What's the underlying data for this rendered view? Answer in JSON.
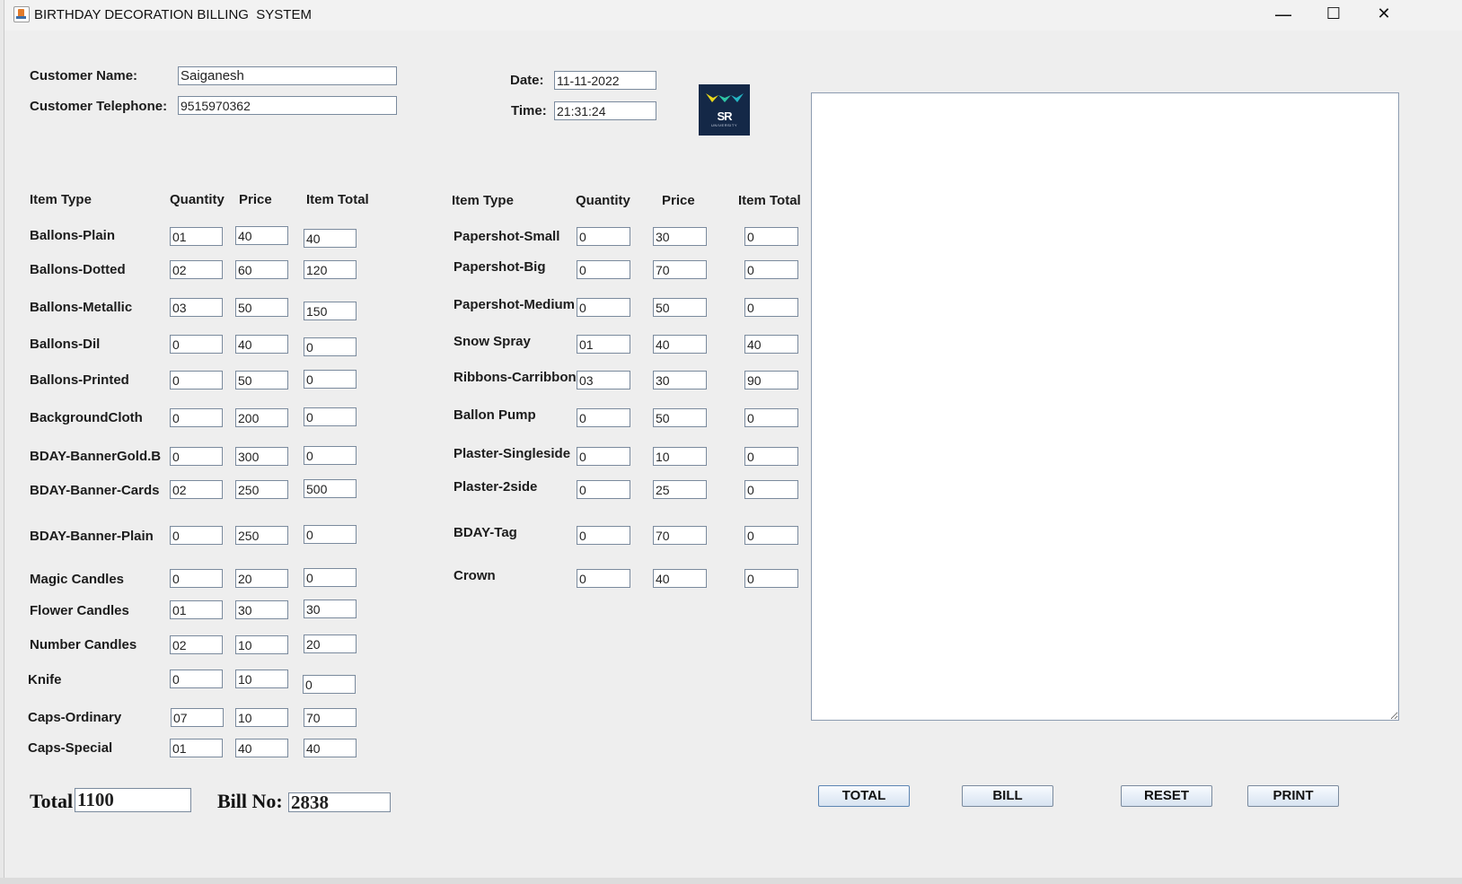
{
  "window": {
    "title": "BIRTHDAY DECORATION BILLING  SYSTEM",
    "minimize_glyph": "—",
    "maximize_glyph": "☐",
    "close_glyph": "✕"
  },
  "customer": {
    "name_label": "Customer Name:",
    "name_value": "Saiganesh",
    "phone_label": "Customer Telephone:",
    "phone_value": "9515970362"
  },
  "datetime": {
    "date_label": "Date:",
    "date_value": "11-11-2022",
    "time_label": "Time:",
    "time_value": "21:31:24"
  },
  "logo": {
    "text": "SR",
    "subtext": "UNIVERSITY",
    "colors": {
      "background": "#142847",
      "yellow": "#e8d71c",
      "teal": "#24b5c4"
    }
  },
  "headers": {
    "left": {
      "item": "Item Type",
      "qty": "Quantity",
      "price": "Price",
      "total": "Item Total"
    },
    "right": {
      "item": "Item Type",
      "qty": "Quantity",
      "price": "Price",
      "total": "Item Total"
    }
  },
  "left_items": [
    {
      "name": "Ballons-Plain",
      "qty": "01",
      "price": "40",
      "total": "40"
    },
    {
      "name": "Ballons-Dotted",
      "qty": "02",
      "price": "60",
      "total": "120"
    },
    {
      "name": "Ballons-Metallic",
      "qty": "03",
      "price": "50",
      "total": "150"
    },
    {
      "name": "Ballons-Dil",
      "qty": "0",
      "price": "40",
      "total": "0"
    },
    {
      "name": "Ballons-Printed",
      "qty": "0",
      "price": "50",
      "total": "0"
    },
    {
      "name": "BackgroundCloth",
      "qty": "0",
      "price": "200",
      "total": "0"
    },
    {
      "name": "BDAY-BannerGold.B",
      "qty": "0",
      "price": "300",
      "total": "0"
    },
    {
      "name": "BDAY-Banner-Cards",
      "qty": "02",
      "price": "250",
      "total": "500"
    },
    {
      "name": "BDAY-Banner-Plain",
      "qty": "0",
      "price": "250",
      "total": "0"
    },
    {
      "name": "Magic Candles",
      "qty": "0",
      "price": "20",
      "total": "0"
    },
    {
      "name": "Flower Candles",
      "qty": "01",
      "price": "30",
      "total": "30"
    },
    {
      "name": "Number Candles",
      "qty": "02",
      "price": "10",
      "total": "20"
    },
    {
      "name": "Knife",
      "qty": "0",
      "price": "10",
      "total": "0"
    },
    {
      "name": "Caps-Ordinary",
      "qty": "07",
      "price": "10",
      "total": "70"
    },
    {
      "name": "Caps-Special",
      "qty": "01",
      "price": "40",
      "total": "40"
    }
  ],
  "right_items": [
    {
      "name": "Papershot-Small",
      "qty": "0",
      "price": "30",
      "total": "0"
    },
    {
      "name": "Papershot-Big",
      "qty": "0",
      "price": "70",
      "total": "0"
    },
    {
      "name": "Papershot-Medium",
      "qty": "0",
      "price": "50",
      "total": "0"
    },
    {
      "name": "Snow Spray",
      "qty": "01",
      "price": "40",
      "total": "40"
    },
    {
      "name": "Ribbons-Carribbon",
      "qty": "03",
      "price": "30",
      "total": "90"
    },
    {
      "name": "Ballon Pump",
      "qty": "0",
      "price": "50",
      "total": "0"
    },
    {
      "name": "Plaster-Singleside",
      "qty": "0",
      "price": "10",
      "total": "0"
    },
    {
      "name": "Plaster-2side",
      "qty": "0",
      "price": "25",
      "total": "0"
    },
    {
      "name": "BDAY-Tag",
      "qty": "0",
      "price": "70",
      "total": "0"
    },
    {
      "name": "Crown",
      "qty": "0",
      "price": "40",
      "total": "0"
    }
  ],
  "summary": {
    "total_label": "Total",
    "total_value": "1100",
    "bill_label": "Bill No:",
    "bill_value": "2838"
  },
  "bill_text": "",
  "buttons": {
    "total": "TOTAL",
    "bill": "BILL",
    "reset": "RESET",
    "print": "PRINT"
  }
}
